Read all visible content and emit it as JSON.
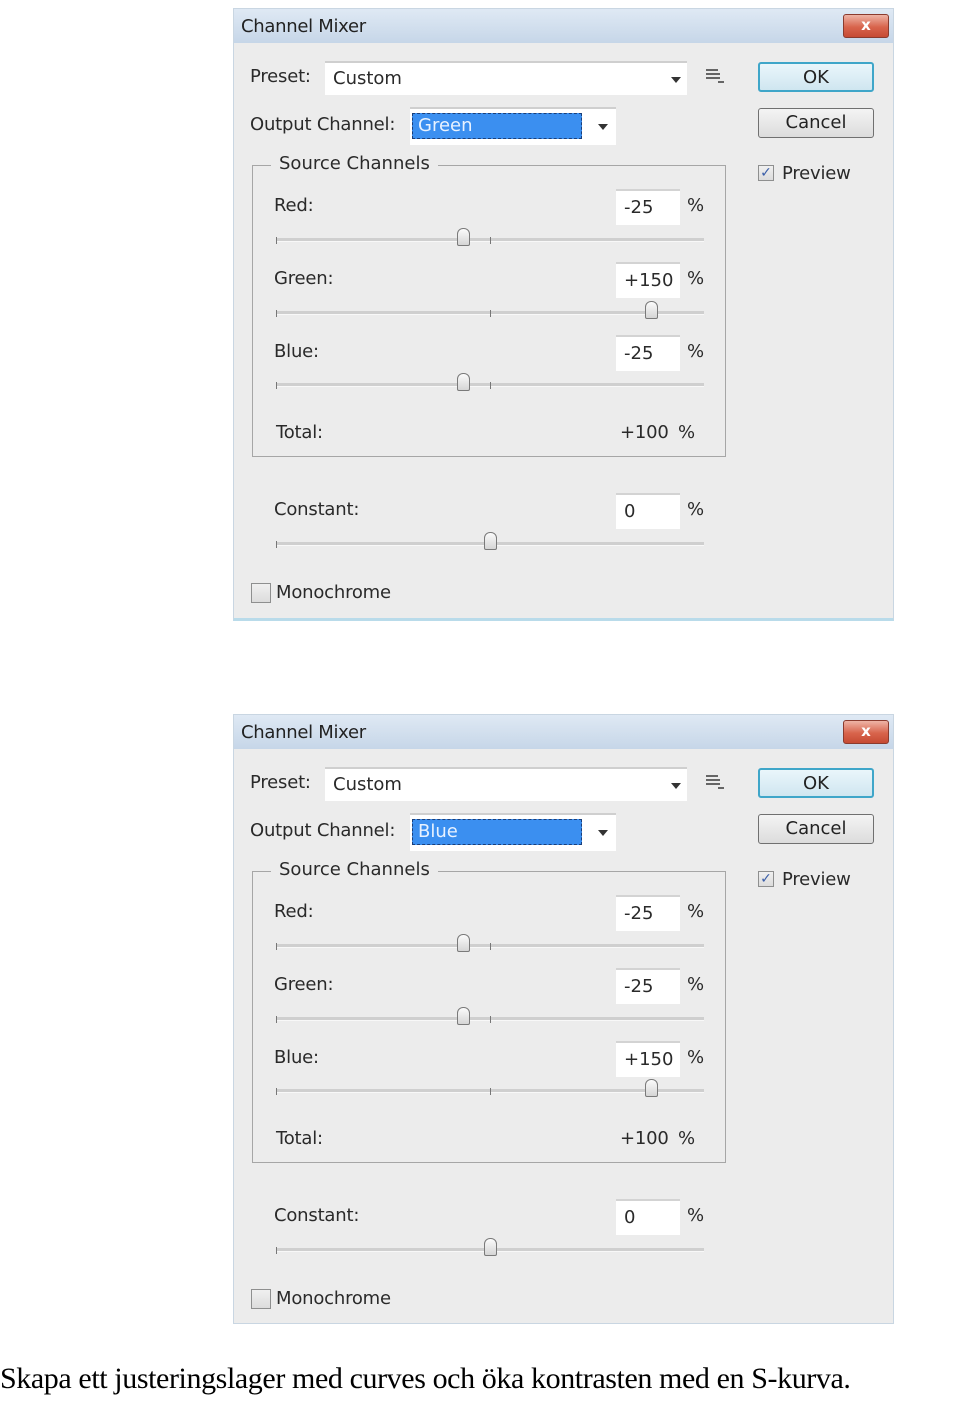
{
  "dialogs": [
    {
      "title": "Channel Mixer",
      "close_label": "x",
      "preset_label": "Preset:",
      "preset_value": "Custom",
      "output_channel_label": "Output Channel:",
      "output_channel_value": "Green",
      "ok_label": "OK",
      "cancel_label": "Cancel",
      "preview_label": "Preview",
      "preview_checked": true,
      "preview_check_glyph": "✓",
      "source_channels_title": "Source Channels",
      "channels": [
        {
          "label": "Red:",
          "value": "-25",
          "percent": -25
        },
        {
          "label": "Green:",
          "value": "+150",
          "percent": 150
        },
        {
          "label": "Blue:",
          "value": "-25",
          "percent": -25
        }
      ],
      "slider_range": [
        -200,
        200
      ],
      "constant_slider_range": [
        -200,
        200
      ],
      "pct_sign": "%",
      "total_label": "Total:",
      "total_value": "+100",
      "constant_label": "Constant:",
      "constant_value": "0",
      "constant_percent": 0,
      "monochrome_label": "Monochrome",
      "monochrome_checked": false
    },
    {
      "title": "Channel Mixer",
      "close_label": "x",
      "preset_label": "Preset:",
      "preset_value": "Custom",
      "output_channel_label": "Output Channel:",
      "output_channel_value": "Blue",
      "ok_label": "OK",
      "cancel_label": "Cancel",
      "preview_label": "Preview",
      "preview_checked": true,
      "preview_check_glyph": "✓",
      "source_channels_title": "Source Channels",
      "channels": [
        {
          "label": "Red:",
          "value": "-25",
          "percent": -25
        },
        {
          "label": "Green:",
          "value": "-25",
          "percent": -25
        },
        {
          "label": "Blue:",
          "value": "+150",
          "percent": 150
        }
      ],
      "slider_range": [
        -200,
        200
      ],
      "constant_slider_range": [
        -200,
        200
      ],
      "pct_sign": "%",
      "total_label": "Total:",
      "total_value": "+100",
      "constant_label": "Constant:",
      "constant_value": "0",
      "constant_percent": 0,
      "monochrome_label": "Monochrome",
      "monochrome_checked": false
    }
  ],
  "caption": "Skapa ett justeringslager med curves och öka kontrasten med en S-kurva."
}
